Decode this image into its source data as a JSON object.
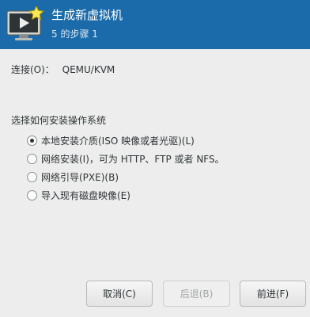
{
  "header": {
    "title": "生成新虚拟机",
    "step": "5 的步骤 1",
    "icon": "monitor-with-star-icon"
  },
  "connection": {
    "label": "连接(O)：",
    "value": "QEMU/KVM"
  },
  "install": {
    "label": "选择如何安装操作系统",
    "selected_index": 0,
    "options": [
      "本地安装介质(ISO 映像或者光驱)(L)",
      "网络安装(I)，可为 HTTP、FTP 或者 NFS。",
      "网络引导(PXE)(B)",
      "导入现有磁盘映像(E)"
    ]
  },
  "buttons": {
    "cancel": "取消(C)",
    "back": "后退(B)",
    "forward": "前进(F)"
  },
  "colors": {
    "header_bg": "#1b6bab",
    "window_bg": "#ededed"
  }
}
